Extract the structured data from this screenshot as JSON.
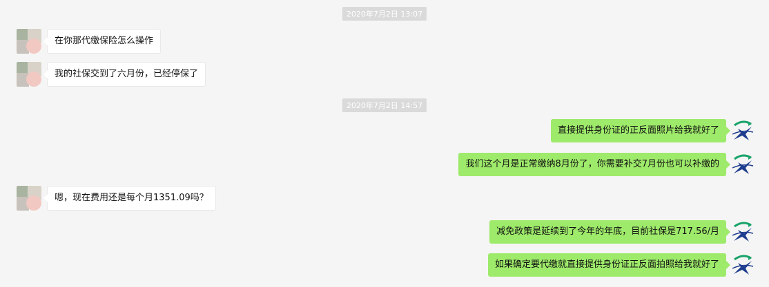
{
  "timestamps": [
    "2020年7月2日 13:07",
    "2020年7月2日 14:57"
  ],
  "messages": [
    {
      "side": "in",
      "text": "在你那代缴保险怎么操作"
    },
    {
      "side": "in",
      "text": "我的社保交到了六月份，已经停保了"
    },
    {
      "side": "out",
      "text": "直接提供身份证的正反面照片给我就好了"
    },
    {
      "side": "out",
      "text": "我们这个月是正常缴纳8月份了，你需要补交7月份也可以补缴的"
    },
    {
      "side": "in",
      "text": "嗯，现在费用还是每个月1351.09吗？"
    },
    {
      "side": "out",
      "text": "减免政策是延续到了今年的年底，目前社保是717.56/月"
    },
    {
      "side": "out",
      "text": "如果确定要代缴就直接提供身份证正反面拍照给我就好了"
    }
  ],
  "icons": {
    "contact_avatar": "blurred-contact-avatar",
    "self_avatar": "company-logo-avatar"
  },
  "colors": {
    "background": "#f5f5f5",
    "incoming_bubble": "#ffffff",
    "outgoing_bubble": "#9eea6a",
    "timestamp_bg": "#dadada",
    "logo_blue": "#1f3d8f",
    "logo_green": "#19a36a"
  }
}
